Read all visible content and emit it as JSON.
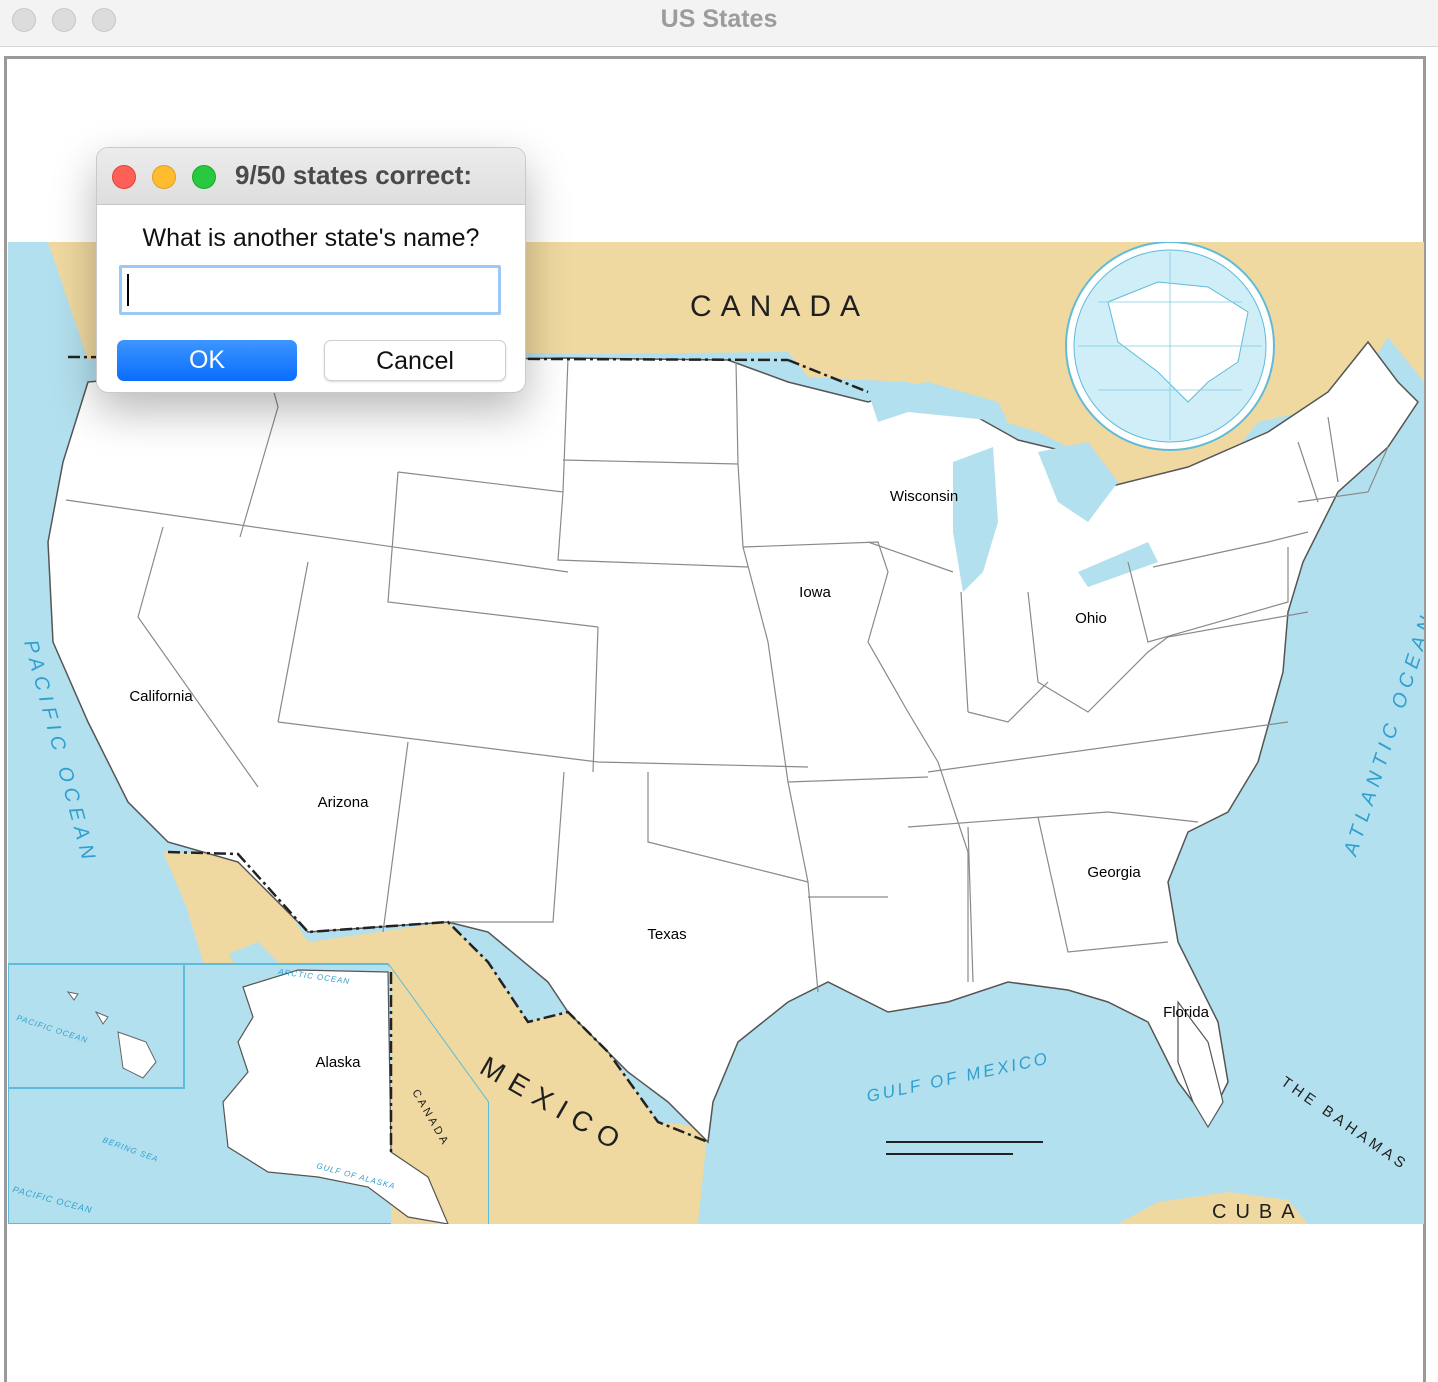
{
  "window": {
    "title": "US States"
  },
  "dialog": {
    "title": "9/50 states correct:",
    "prompt": "What is another state's name?",
    "input_value": "",
    "ok_label": "OK",
    "cancel_label": "Cancel"
  },
  "map": {
    "country_labels": {
      "canada": "CANADA",
      "mexico": "MEXICO",
      "cuba": "CUBA",
      "canada_inset": "CANADA",
      "bahamas": "THE BAHAMAS"
    },
    "water_labels": {
      "pacific": "PACIFIC OCEAN",
      "atlantic": "ATLANTIC OCEAN",
      "gulf": "GULF OF MEXICO",
      "gulf_alaska": "GULF OF ALASKA",
      "bering": "BERING SEA",
      "arctic": "ARCTIC OCEAN",
      "pacific_hawaii": "PACIFIC OCEAN",
      "pacific_alaska": "PACIFIC OCEAN"
    },
    "guessed_states": [
      {
        "name": "Wisconsin"
      },
      {
        "name": "Iowa"
      },
      {
        "name": "Ohio"
      },
      {
        "name": "California"
      },
      {
        "name": "Arizona"
      },
      {
        "name": "Georgia"
      },
      {
        "name": "Texas"
      },
      {
        "name": "Florida"
      },
      {
        "name": "Alaska"
      }
    ],
    "colors": {
      "water": "#b3e0ee",
      "foreign_land": "#f0d9a0",
      "us_land": "#ffffff",
      "border": "#6e6e6e"
    }
  }
}
